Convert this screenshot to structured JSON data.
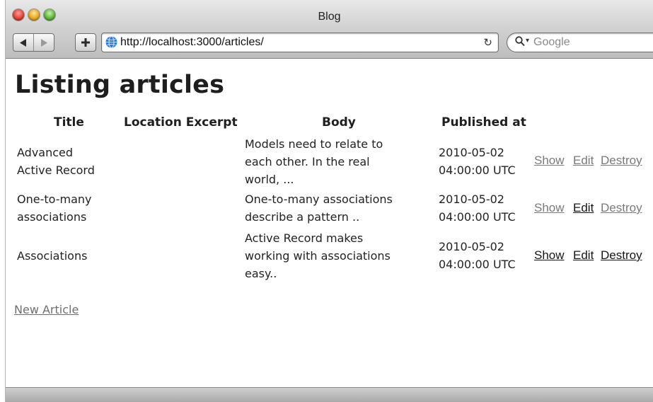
{
  "window": {
    "title": "Blog"
  },
  "toolbar": {
    "url": "http://localhost:3000/articles/",
    "search_placeholder": "Google"
  },
  "page": {
    "heading": "Listing articles",
    "columns": [
      "Title",
      "Location Excerpt",
      "Body",
      "Published at"
    ],
    "rows": [
      {
        "title": [
          "Advanced",
          "Active Record"
        ],
        "location_excerpt": "",
        "body": [
          "Models need to relate to",
          "each other. In the real",
          "world, ..."
        ],
        "published_at": [
          "2010-05-02",
          "04:00:00 UTC"
        ],
        "actions": [
          "Show",
          "Edit",
          "Destroy"
        ]
      },
      {
        "title": [
          "One-to-many",
          "associations"
        ],
        "location_excerpt": "",
        "body": [
          "One-to-many associations",
          "describe a pattern .."
        ],
        "published_at": [
          "2010-05-02",
          "04:00:00 UTC"
        ],
        "actions": [
          "Show",
          "Edit",
          "Destroy"
        ]
      },
      {
        "title": [
          "Associations"
        ],
        "location_excerpt": "",
        "body": [
          "Active Record makes",
          "working with associations",
          "easy.."
        ],
        "published_at": [
          "2010-05-02",
          "04:00:00 UTC"
        ],
        "actions": [
          "Show",
          "Edit",
          "Destroy"
        ]
      }
    ],
    "new_link": "New Article"
  },
  "icons": {
    "back": "back-arrow-icon",
    "forward": "forward-arrow-icon",
    "add": "plus-icon",
    "site": "globe-icon",
    "reload": "reload-icon",
    "search": "search-icon"
  },
  "colors": {
    "link_visited": "#7a7a7a",
    "link_active": "#151515",
    "text": "#1e1e1e"
  }
}
